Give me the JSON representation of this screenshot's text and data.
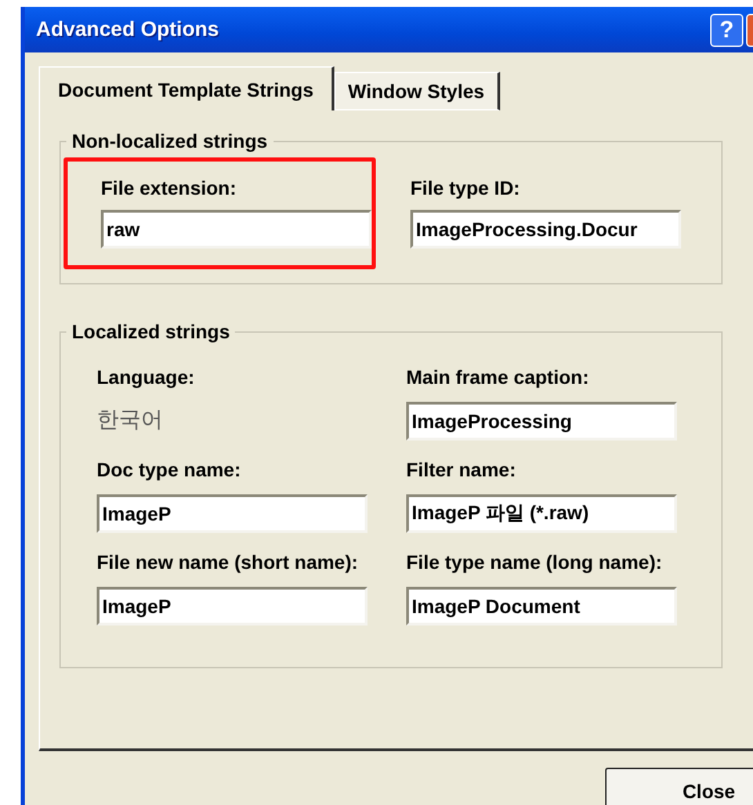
{
  "window": {
    "title": "Advanced Options",
    "help_button": "?"
  },
  "tabs": [
    {
      "label": "Document Template Strings",
      "selected": true
    },
    {
      "label": "Window Styles",
      "selected": false
    }
  ],
  "non_localized": {
    "title": "Non-localized strings",
    "fields": [
      {
        "label": "File extension:",
        "value": "raw",
        "highlighted": true
      },
      {
        "label": "File type ID:",
        "value": "ImageProcessing.Docur",
        "highlighted": false
      }
    ]
  },
  "localized": {
    "title": "Localized strings",
    "fields": [
      {
        "label": "Language:",
        "value": "한국어",
        "kind": "static"
      },
      {
        "label": "Main frame caption:",
        "value": "ImageProcessing",
        "kind": "field"
      },
      {
        "label": "Doc type name:",
        "value": "ImageP",
        "kind": "field"
      },
      {
        "label": "Filter name:",
        "value": "ImageP 파일 (*.raw)",
        "kind": "field"
      },
      {
        "label": "File new name (short name):",
        "value": "ImageP",
        "kind": "field"
      },
      {
        "label": "File type name (long name):",
        "value": "ImageP Document",
        "kind": "field"
      }
    ]
  },
  "buttons": [
    "Close"
  ]
}
